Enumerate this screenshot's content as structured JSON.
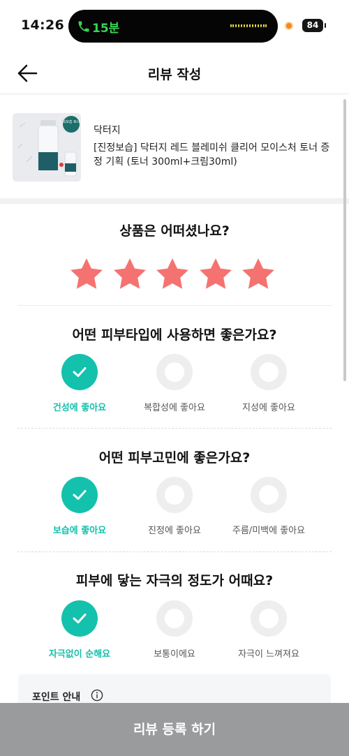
{
  "status_bar": {
    "time": "14:26",
    "call_duration": "15분",
    "battery": "84"
  },
  "header": {
    "title": "리뷰 작성"
  },
  "product": {
    "brand": "닥터지",
    "name": "[진정보습] 닥터지 레드 블레미쉬 클리어 모이스처 토너 증정 기획 (토너 300ml+크림30ml)",
    "badge": "쏙보습 토너"
  },
  "rating": {
    "question": "상품은 어떠셨나요?",
    "stars": 5,
    "max_stars": 5,
    "star_color": "#f47370"
  },
  "sections": [
    {
      "question": "어떤 피부타입에 사용하면 좋은가요?",
      "options": [
        {
          "label": "건성에 좋아요",
          "selected": true
        },
        {
          "label": "복합성에 좋아요",
          "selected": false
        },
        {
          "label": "지성에 좋아요",
          "selected": false
        }
      ]
    },
    {
      "question": "어떤 피부고민에 좋은가요?",
      "options": [
        {
          "label": "보습에 좋아요",
          "selected": true
        },
        {
          "label": "진정에 좋아요",
          "selected": false
        },
        {
          "label": "주름/미백에 좋아요",
          "selected": false
        }
      ]
    },
    {
      "question": "피부에 닿는 자극의 정도가 어때요?",
      "options": [
        {
          "label": "자극없이 순해요",
          "selected": true
        },
        {
          "label": "보통이에요",
          "selected": false
        },
        {
          "label": "자극이 느껴져요",
          "selected": false
        }
      ]
    }
  ],
  "point_info": {
    "title": "포인트 안내"
  },
  "submit": {
    "label": "리뷰 등록 하기"
  },
  "colors": {
    "accent": "#14c1ad",
    "button_disabled": "#9a9b9d"
  }
}
